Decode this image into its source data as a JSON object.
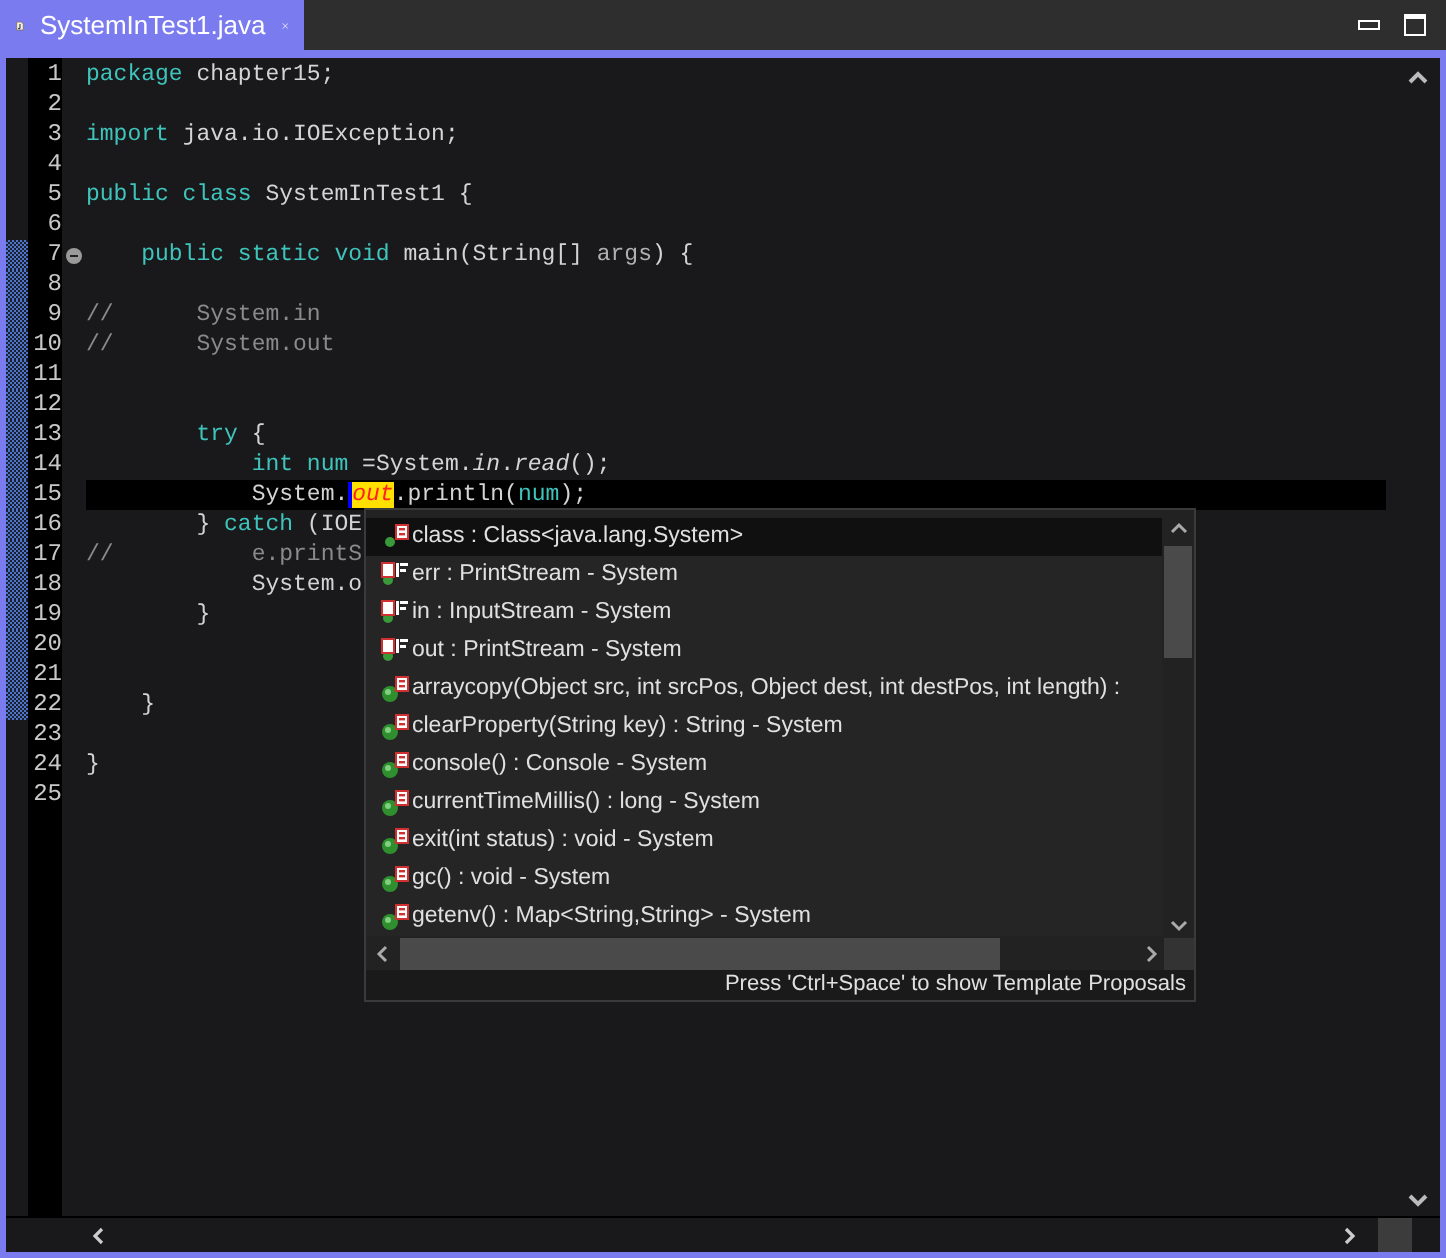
{
  "tab": {
    "title": "SystemInTest1.java",
    "selected": true
  },
  "lines": [
    {
      "n": "1",
      "marked": false,
      "fold": false,
      "current": false,
      "tokens": [
        {
          "kind": "keyword",
          "text": "package"
        },
        {
          "kind": "text",
          "text": " chapter15;"
        }
      ]
    },
    {
      "n": "2",
      "marked": false,
      "fold": false,
      "current": false
    },
    {
      "n": "3",
      "marked": false,
      "fold": false,
      "current": false,
      "tokens": [
        {
          "kind": "keyword",
          "text": "import"
        },
        {
          "kind": "text",
          "text": " java.io.IOException;"
        }
      ]
    },
    {
      "n": "4",
      "marked": false,
      "fold": false,
      "current": false
    },
    {
      "n": "5",
      "marked": false,
      "fold": false,
      "current": false,
      "tokens": [
        {
          "kind": "keyword",
          "text": "public class"
        },
        {
          "kind": "text",
          "text": " SystemInTest1 {"
        }
      ]
    },
    {
      "n": "6",
      "marked": false,
      "fold": false,
      "current": false
    },
    {
      "n": "7",
      "marked": true,
      "fold": true,
      "current": false,
      "tokens": [
        {
          "kind": "keyword",
          "text": "    public static void"
        },
        {
          "kind": "text",
          "text": " main(String[] "
        },
        {
          "kind": "param",
          "text": "args"
        },
        {
          "kind": "text",
          "text": ") {"
        }
      ]
    },
    {
      "n": "8",
      "marked": true,
      "fold": false,
      "current": false
    },
    {
      "n": "9",
      "marked": true,
      "fold": false,
      "current": false,
      "tokens": [
        {
          "kind": "comment",
          "text": "//      System.in"
        }
      ]
    },
    {
      "n": "10",
      "marked": true,
      "fold": false,
      "current": false,
      "tokens": [
        {
          "kind": "comment",
          "text": "//      System.out"
        }
      ]
    },
    {
      "n": "11",
      "marked": true,
      "fold": false,
      "current": false
    },
    {
      "n": "12",
      "marked": true,
      "fold": false,
      "current": false
    },
    {
      "n": "13",
      "marked": true,
      "fold": false,
      "current": false,
      "tokens": [
        {
          "kind": "keyword",
          "text": "        try"
        },
        {
          "kind": "text",
          "text": " {"
        }
      ]
    },
    {
      "n": "14",
      "marked": true,
      "fold": false,
      "current": false,
      "tokens": [
        {
          "kind": "keyword",
          "text": "            int"
        },
        {
          "kind": "variable",
          "text": " num"
        },
        {
          "kind": "text",
          "text": " =System."
        },
        {
          "kind": "static",
          "text": "in"
        },
        {
          "kind": "text",
          "text": "."
        },
        {
          "kind": "static",
          "text": "read"
        },
        {
          "kind": "text",
          "text": "();"
        }
      ]
    },
    {
      "n": "15",
      "marked": true,
      "fold": false,
      "current": true,
      "tokens": [
        {
          "kind": "text",
          "text": "            System."
        },
        {
          "kind": "highlight",
          "text": "out"
        },
        {
          "kind": "text",
          "text": ".println("
        },
        {
          "kind": "variable",
          "text": "num"
        },
        {
          "kind": "text",
          "text": ");"
        }
      ]
    },
    {
      "n": "16",
      "marked": true,
      "fold": false,
      "current": false,
      "tokens": [
        {
          "kind": "text",
          "text": "        } "
        },
        {
          "kind": "keyword",
          "text": "catch"
        },
        {
          "kind": "text",
          "text": " (IOE"
        }
      ]
    },
    {
      "n": "17",
      "marked": true,
      "fold": false,
      "current": false,
      "tokens": [
        {
          "kind": "comment",
          "text": "//          e.printS"
        }
      ]
    },
    {
      "n": "18",
      "marked": true,
      "fold": false,
      "current": false,
      "tokens": [
        {
          "kind": "text",
          "text": "            System.o"
        }
      ]
    },
    {
      "n": "19",
      "marked": true,
      "fold": false,
      "current": false,
      "tokens": [
        {
          "kind": "text",
          "text": "        }"
        }
      ]
    },
    {
      "n": "20",
      "marked": true,
      "fold": false,
      "current": false
    },
    {
      "n": "21",
      "marked": true,
      "fold": false,
      "current": false
    },
    {
      "n": "22",
      "marked": true,
      "fold": false,
      "current": false,
      "tokens": [
        {
          "kind": "text",
          "text": "    }"
        }
      ]
    },
    {
      "n": "23",
      "marked": false,
      "fold": false,
      "current": false
    },
    {
      "n": "24",
      "marked": false,
      "fold": false,
      "current": false,
      "tokens": [
        {
          "kind": "text",
          "text": "}"
        }
      ]
    },
    {
      "n": "25",
      "marked": false,
      "fold": false,
      "current": false
    }
  ],
  "proposals": {
    "items": [
      {
        "kind": "class",
        "selected": true,
        "text": "class : Class<java.lang.System>"
      },
      {
        "kind": "field",
        "selected": false,
        "text": "err : PrintStream - System"
      },
      {
        "kind": "field",
        "selected": false,
        "text": "in : InputStream - System"
      },
      {
        "kind": "field",
        "selected": false,
        "text": "out : PrintStream - System"
      },
      {
        "kind": "method",
        "selected": false,
        "text": "arraycopy(Object src, int srcPos, Object dest, int destPos, int length) :"
      },
      {
        "kind": "method",
        "selected": false,
        "text": "clearProperty(String key) : String - System"
      },
      {
        "kind": "method",
        "selected": false,
        "text": "console() : Console - System"
      },
      {
        "kind": "method",
        "selected": false,
        "text": "currentTimeMillis() : long - System"
      },
      {
        "kind": "method",
        "selected": false,
        "text": "exit(int status) : void - System"
      },
      {
        "kind": "method",
        "selected": false,
        "text": "gc() : void - System"
      },
      {
        "kind": "method",
        "selected": false,
        "text": "getenv() : Map<String,String> - System"
      }
    ],
    "status": "Press 'Ctrl+Space' to show Template Proposals"
  }
}
